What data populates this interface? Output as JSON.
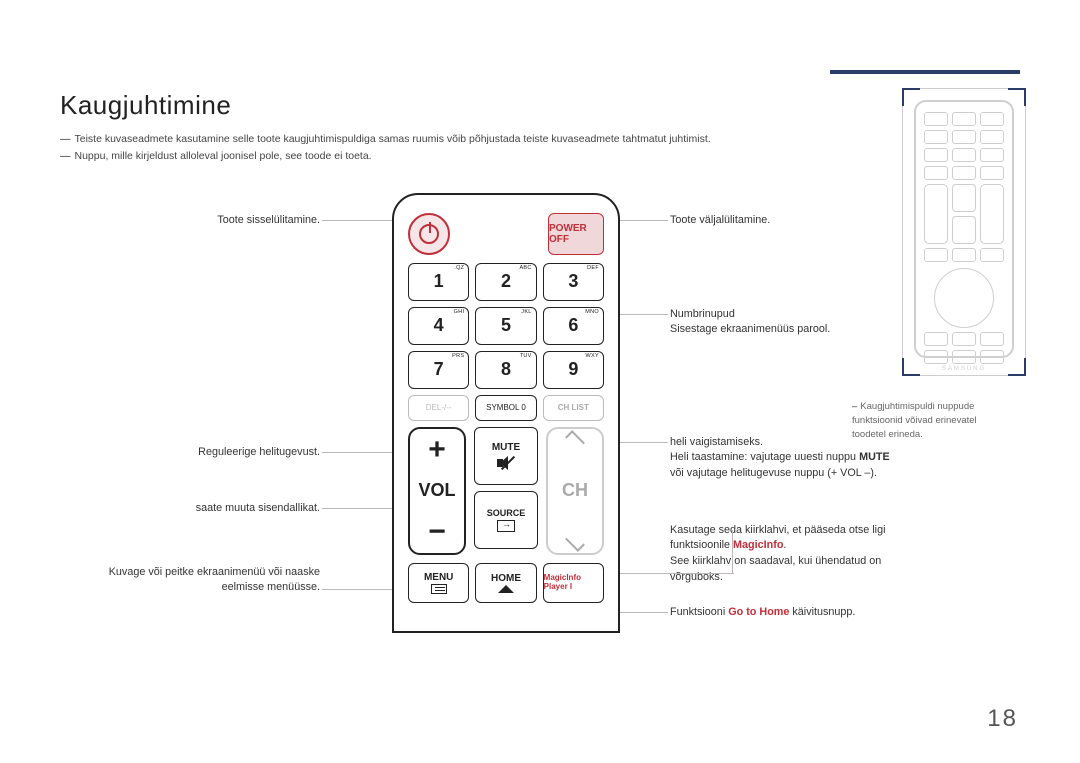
{
  "heading": "Kaugjuhtimine",
  "note1": "Teiste kuvaseadmete kasutamine selle toote kaugjuhtimispuldiga samas ruumis võib põhjustada teiste kuvaseadmete tahtmatut juhtimist.",
  "note2": "Nuppu, mille kirjeldust alloleval joonisel pole, see toode ei toeta.",
  "left": {
    "power_on": "Toote sisselülitamine.",
    "volume": "Reguleerige helitugevust.",
    "source": "saate muuta sisendallikat.",
    "menu": "Kuvage või peitke ekraanimenüü või naaske eelmisse menüüsse."
  },
  "right": {
    "power_off": "Toote väljalülitamine.",
    "numbers1": "Numbrinupud",
    "numbers2": "Sisestage ekraanimenüüs parool.",
    "mute1": "heli vaigistamiseks.",
    "mute2_a": "Heli taastamine: vajutage uuesti nuppu ",
    "mute2_b": "MUTE",
    "mute3": "või vajutage helitugevuse nuppu (+ VOL –).",
    "magic1": "Kasutage seda kiirklahvi, et pääseda otse ligi funktsioonile ",
    "magic1_b": "MagicInfo",
    "magic2": "See kiirklahv on saadaval, kui ühendatud on võrguboks.",
    "home_a": "Funktsiooni ",
    "home_b": "Go to Home",
    "home_c": " käivitusnupp."
  },
  "remote": {
    "power_off": "POWER OFF",
    "keys": {
      "k1": "1",
      "k1s": ".QZ",
      "k2": "2",
      "k2s": "ABC",
      "k3": "3",
      "k3s": "DEF",
      "k4": "4",
      "k4s": "GHI",
      "k5": "5",
      "k5s": "JKL",
      "k6": "6",
      "k6s": "MNO",
      "k7": "7",
      "k7s": "PRS",
      "k8": "8",
      "k8s": "TUV",
      "k9": "9",
      "k9s": "WXY"
    },
    "del": "DEL-/--",
    "sym": "SYMBOL 0",
    "chlist": "CH LIST",
    "mute": "MUTE",
    "vol": "VOL",
    "ch": "CH",
    "source": "SOURCE",
    "menu": "MENU",
    "home": "HOME",
    "magic": "MagicInfo Player I"
  },
  "ghost_brand": "SAMSUNG",
  "side_note": "Kaugjuhtimispuldi nuppude funktsioonid võivad erinevatel toodetel erineda.",
  "page": "18"
}
